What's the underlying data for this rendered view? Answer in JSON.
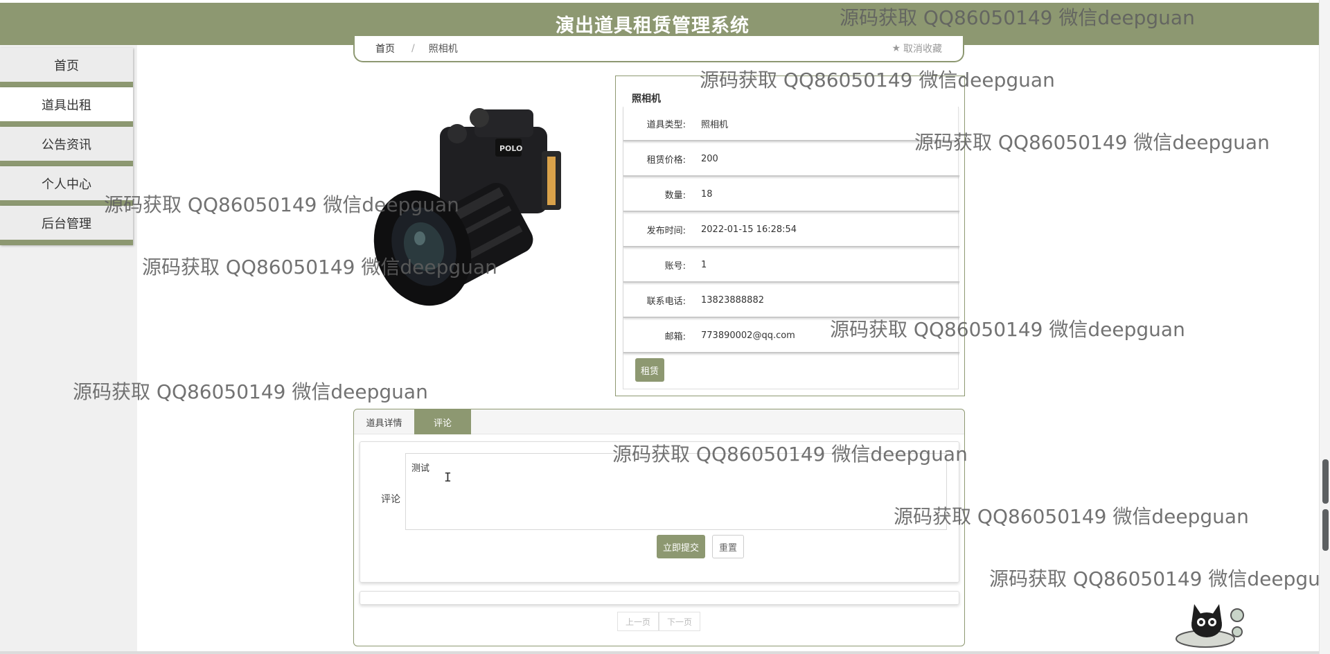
{
  "header": {
    "title": "演出道具租赁管理系统"
  },
  "sidebar": {
    "items": [
      {
        "label": "首页"
      },
      {
        "label": "道具出租"
      },
      {
        "label": "公告资讯"
      },
      {
        "label": "个人中心"
      },
      {
        "label": "后台管理"
      }
    ],
    "active_index": 1
  },
  "breadcrumb": {
    "home": "首页",
    "separator": "/",
    "current": "照相机",
    "favorite_label": "取消收藏"
  },
  "product": {
    "name": "照相机",
    "image_desc": "camera",
    "fields": [
      {
        "label": "道具类型:",
        "value": "照相机"
      },
      {
        "label": "租赁价格:",
        "value": "200"
      },
      {
        "label": "数量:",
        "value": "18"
      },
      {
        "label": "发布时间:",
        "value": "2022-01-15 16:28:54"
      },
      {
        "label": "账号:",
        "value": "1"
      },
      {
        "label": "联系电话:",
        "value": "13823888882"
      },
      {
        "label": "邮箱:",
        "value": "773890002@qq.com"
      }
    ],
    "rent_button": "租赁"
  },
  "tabs": {
    "items": [
      {
        "label": "道具详情"
      },
      {
        "label": "评论"
      }
    ],
    "active_index": 1
  },
  "comment": {
    "label": "评论",
    "value": "测试",
    "submit_button": "立即提交",
    "reset_button": "重置"
  },
  "pager": {
    "prev": "上一页",
    "next": "下一页"
  },
  "watermark": {
    "text": "源码获取 QQ86050149 微信deepguan",
    "text_cut": "源码获取 QQ86050149 微信deepgu"
  },
  "colors": {
    "accent": "#8d9871",
    "sidebar_bg": "#f0f0f0"
  }
}
